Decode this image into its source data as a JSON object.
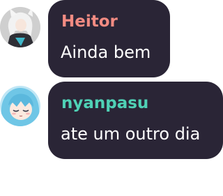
{
  "messages": [
    {
      "author": "Heitor",
      "author_color": "#f28b82",
      "text": "Ainda bem",
      "avatar_icon": "white-haired-character-avatar-icon"
    },
    {
      "author": "nyanpasu",
      "author_color": "#4fd1b5",
      "text": "ate um outro dia",
      "avatar_icon": "blue-haired-anime-avatar-icon"
    }
  ]
}
